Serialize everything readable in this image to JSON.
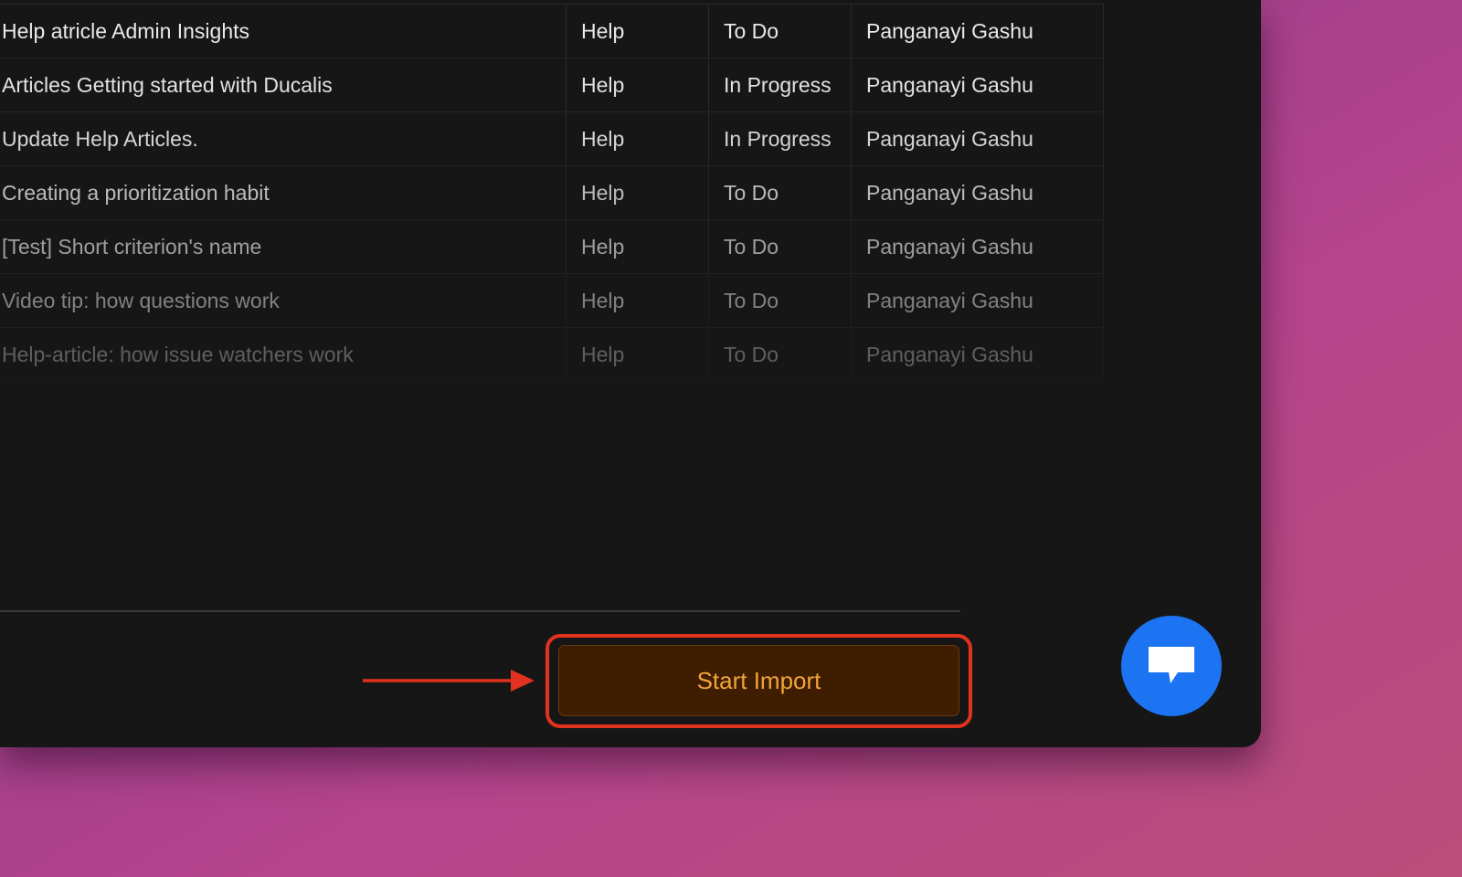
{
  "table": {
    "rows": [
      {
        "title": "Help atricle Admin Insights",
        "type": "Help",
        "status": "To Do",
        "owner": "Panganayi Gashu"
      },
      {
        "title": "Articles Getting started with Ducalis",
        "type": "Help",
        "status": "In Progress",
        "owner": "Panganayi Gashu"
      },
      {
        "title": "Update Help Articles.",
        "type": "Help",
        "status": "In Progress",
        "owner": "Panganayi Gashu"
      },
      {
        "title": "Creating a prioritization habit",
        "type": "Help",
        "status": "To Do",
        "owner": "Panganayi Gashu"
      },
      {
        "title": "[Test] Short criterion's name",
        "type": "Help",
        "status": "To Do",
        "owner": "Panganayi Gashu"
      },
      {
        "title": "Video tip: how questions work",
        "type": "Help",
        "status": "To Do",
        "owner": "Panganayi Gashu"
      },
      {
        "title": "Help-article: how issue watchers work",
        "type": "Help",
        "status": "To Do",
        "owner": "Panganayi Gashu"
      }
    ]
  },
  "footer": {
    "start_import_label": "Start Import"
  },
  "chat": {
    "icon": "chat-bubble-icon"
  },
  "colors": {
    "button_bg": "#3f1d00",
    "button_text": "#f3a43c",
    "highlight": "#e0321e",
    "chat_button": "#1c74f2",
    "window_bg": "#161616"
  }
}
